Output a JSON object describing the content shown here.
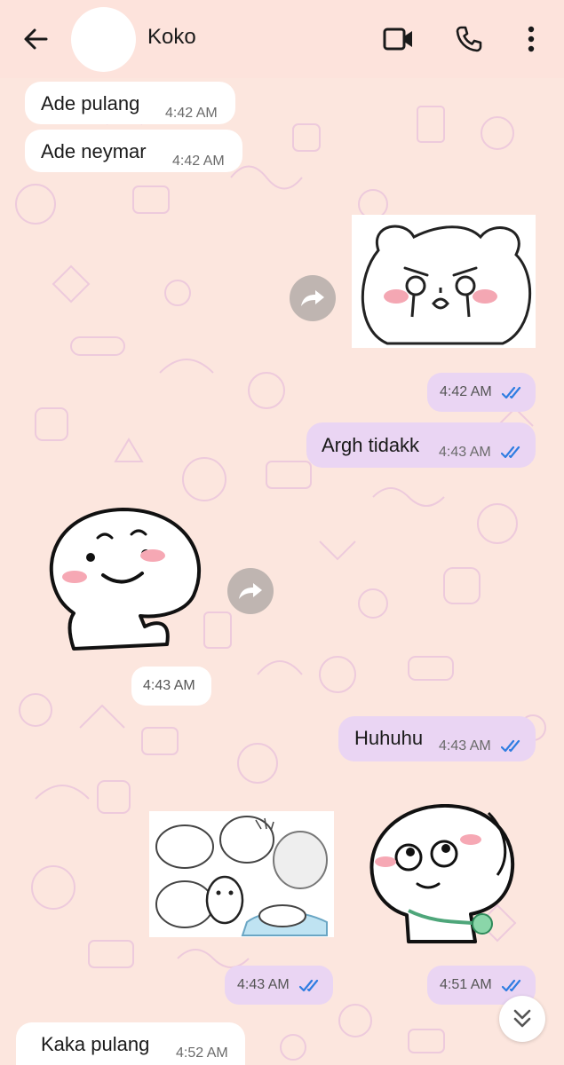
{
  "header": {
    "contact_name": "Koko",
    "back_icon": "arrow-left-icon",
    "video_icon": "video-call-icon",
    "call_icon": "phone-icon",
    "menu_icon": "more-vert-icon"
  },
  "messages": [
    {
      "type": "text",
      "direction": "incoming",
      "text": "Ade pulang",
      "time": "4:42 AM"
    },
    {
      "type": "text",
      "direction": "incoming",
      "text": "Ade neymar",
      "time": "4:42 AM"
    },
    {
      "type": "sticker",
      "direction": "outgoing",
      "sticker": "crying-bear-sticker",
      "time": "4:42 AM",
      "status": "read"
    },
    {
      "type": "text",
      "direction": "outgoing",
      "text": "Argh tidakk",
      "time": "4:43 AM",
      "status": "read"
    },
    {
      "type": "sticker",
      "direction": "incoming",
      "sticker": "smiling-blob-thumbs-up-sticker",
      "time": "4:43 AM"
    },
    {
      "type": "text",
      "direction": "outgoing",
      "text": "Huhuhu",
      "time": "4:43 AM",
      "status": "read"
    },
    {
      "type": "sticker",
      "direction": "outgoing",
      "sticker": "chaotic-bears-sticker",
      "time": "4:43 AM",
      "status": "read"
    },
    {
      "type": "sticker",
      "direction": "outgoing",
      "sticker": "blob-looking-up-sticker",
      "time": "4:51 AM",
      "status": "read"
    },
    {
      "type": "text",
      "direction": "incoming",
      "text": "Kaka pulang",
      "time": "4:52 AM"
    }
  ],
  "controls": {
    "forward_icon": "forward-icon",
    "scroll_down_icon": "double-chevron-down-icon"
  },
  "colors": {
    "background": "#fce6de",
    "incoming_bubble": "#ffffff",
    "outgoing_bubble": "#ead5f3",
    "read_tick": "#2f7de1"
  }
}
